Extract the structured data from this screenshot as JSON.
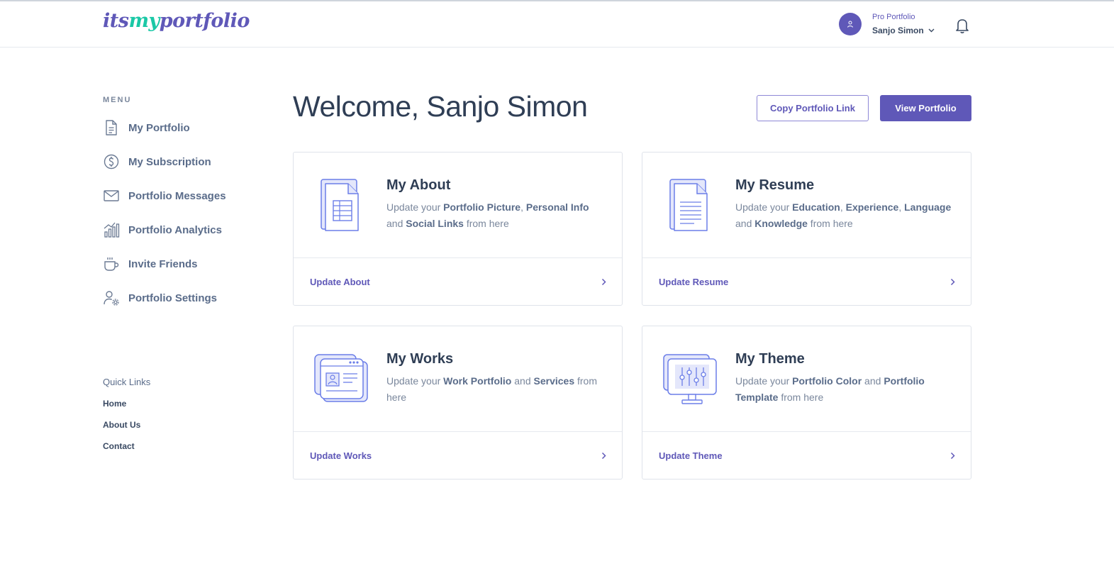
{
  "brand": {
    "logo_part1": "its",
    "logo_part2": "my",
    "logo_part3": "portfolio"
  },
  "user": {
    "plan": "Pro Portfolio",
    "name": "Sanjo Simon"
  },
  "sidebar": {
    "menu_heading": "MENU",
    "items": [
      {
        "label": "My Portfolio",
        "icon": "document-icon"
      },
      {
        "label": "My Subscription",
        "icon": "dollar-circle-icon"
      },
      {
        "label": "Portfolio Messages",
        "icon": "envelope-icon"
      },
      {
        "label": "Portfolio Analytics",
        "icon": "analytics-icon"
      },
      {
        "label": "Invite Friends",
        "icon": "coffee-cup-icon"
      },
      {
        "label": "Portfolio Settings",
        "icon": "user-settings-icon"
      }
    ],
    "quick_links_heading": "Quick Links",
    "quick_links": [
      "Home",
      "About Us",
      "Contact"
    ]
  },
  "main": {
    "welcome": "Welcome, Sanjo Simon",
    "copy_link_label": "Copy Portfolio Link",
    "view_portfolio_label": "View Portfolio",
    "cards": [
      {
        "title": "My About",
        "desc": [
          {
            "t": "Update your ",
            "b": false
          },
          {
            "t": "Portfolio Picture",
            "b": true
          },
          {
            "t": ", ",
            "b": false
          },
          {
            "t": "Personal Info",
            "b": true
          },
          {
            "t": " and ",
            "b": false
          },
          {
            "t": "Social Links",
            "b": true
          },
          {
            "t": " from here",
            "b": false
          }
        ],
        "footer": "Update About",
        "icon": "spreadsheet-document-icon"
      },
      {
        "title": "My Resume",
        "desc": [
          {
            "t": "Update your ",
            "b": false
          },
          {
            "t": "Education",
            "b": true
          },
          {
            "t": ", ",
            "b": false
          },
          {
            "t": "Experience",
            "b": true
          },
          {
            "t": ", ",
            "b": false
          },
          {
            "t": "Language",
            "b": true
          },
          {
            "t": " and ",
            "b": false
          },
          {
            "t": "Knowledge",
            "b": true
          },
          {
            "t": " from here",
            "b": false
          }
        ],
        "footer": "Update Resume",
        "icon": "text-document-icon"
      },
      {
        "title": "My Works",
        "desc": [
          {
            "t": "Update your ",
            "b": false
          },
          {
            "t": "Work Portfolio",
            "b": true
          },
          {
            "t": " and ",
            "b": false
          },
          {
            "t": "Services",
            "b": true
          },
          {
            "t": " from here",
            "b": false
          }
        ],
        "footer": "Update Works",
        "icon": "browser-profile-icon"
      },
      {
        "title": "My Theme",
        "desc": [
          {
            "t": "Update your ",
            "b": false
          },
          {
            "t": "Portfolio Color",
            "b": true
          },
          {
            "t": " and ",
            "b": false
          },
          {
            "t": "Portfolio Template",
            "b": true
          },
          {
            "t": " from here",
            "b": false
          }
        ],
        "footer": "Update Theme",
        "icon": "monitor-sliders-icon"
      }
    ]
  },
  "colors": {
    "accent": "#5f58b8",
    "logo_green": "#1ac8a6",
    "text_dark": "#2f3e55",
    "text_muted": "#7a879c",
    "icon_fill": "#e4e7fb",
    "icon_stroke": "#6b7ee8"
  }
}
